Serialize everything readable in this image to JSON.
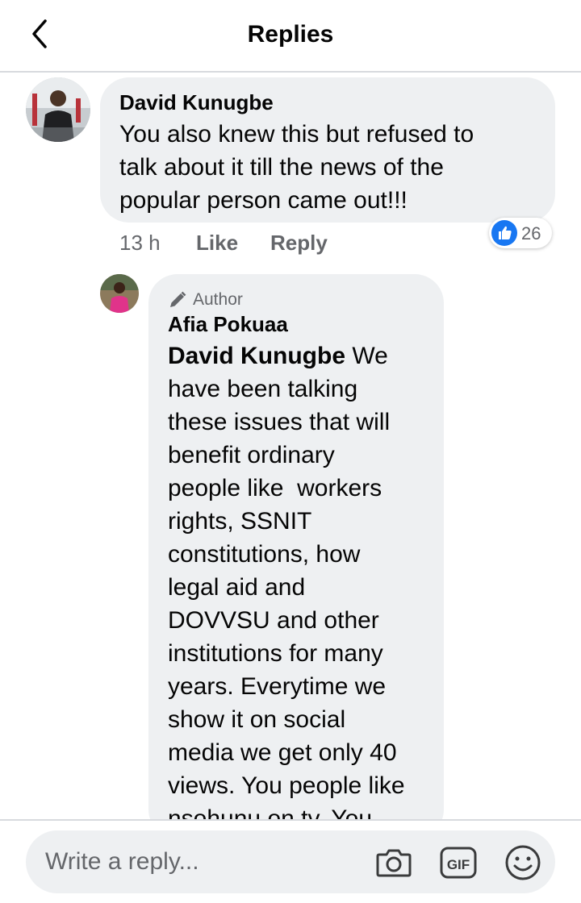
{
  "header": {
    "title": "Replies",
    "back_icon": "chevron-left-icon"
  },
  "comment": {
    "author": "David Kunugbe",
    "text": "You also knew this but refused to talk about it till the news of the popular person came out!!!",
    "lines": [
      "You also knew this but refused to",
      "talk about it till the news of the",
      "popular person came out!!!"
    ],
    "time": "13 h",
    "like_label": "Like",
    "reply_label": "Reply",
    "reaction_icon": "like-reaction-icon",
    "reaction_count": "26"
  },
  "reply": {
    "badge_icon": "pencil-icon",
    "badge_label": "Author",
    "author": "Afia Pokuaa",
    "mention": "David Kunugbe",
    "first_line_rest": " We",
    "lines": [
      "have been talking",
      "these issues that will",
      "benefit ordinary",
      "people like  workers",
      "rights, SSNIT",
      "constitutions, how",
      "legal aid and",
      "DOVVSU and other",
      "institutions for many",
      "years. Everytime we",
      "show it on social",
      "media we get only 40",
      "views. You people like",
      "nsohunu on tv. You"
    ]
  },
  "composer": {
    "placeholder": "Write a reply...",
    "icons": [
      "camera-icon",
      "gif-icon",
      "emoji-icon"
    ],
    "gif_label": "GIF"
  },
  "colors": {
    "accent": "#1877f2",
    "bubble": "#eef0f2",
    "secondary_text": "#65676b"
  }
}
